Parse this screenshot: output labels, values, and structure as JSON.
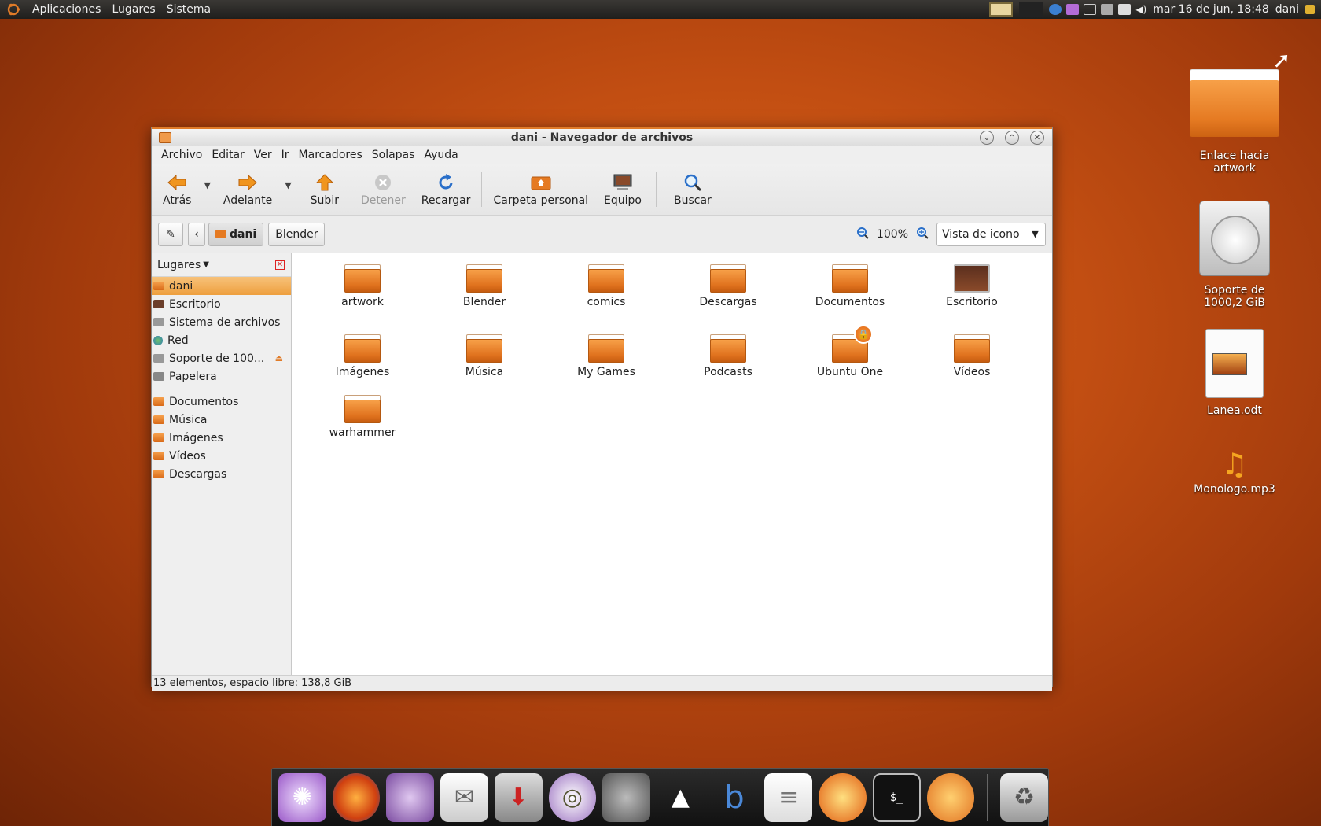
{
  "top_panel": {
    "menus": [
      "Aplicaciones",
      "Lugares",
      "Sistema"
    ],
    "clock": "mar 16 de jun, 18:48",
    "user": "dani"
  },
  "window": {
    "title": "dani - Navegador de archivos",
    "menubar": [
      "Archivo",
      "Editar",
      "Ver",
      "Ir",
      "Marcadores",
      "Solapas",
      "Ayuda"
    ],
    "toolbar": {
      "back": "Atrás",
      "forward": "Adelante",
      "up": "Subir",
      "stop": "Detener",
      "reload": "Recargar",
      "home": "Carpeta personal",
      "computer": "Equipo",
      "search": "Buscar"
    },
    "location": {
      "crumbs": [
        "dani",
        "Blender"
      ],
      "zoom": "100%",
      "view_mode": "Vista de icono"
    },
    "sidebar": {
      "header": "Lugares",
      "places": [
        {
          "label": "dani",
          "icon": "home-folder-icon"
        },
        {
          "label": "Escritorio",
          "icon": "desktop-icon"
        },
        {
          "label": "Sistema de archivos",
          "icon": "drive-icon"
        },
        {
          "label": "Red",
          "icon": "network-icon"
        },
        {
          "label": "Soporte de 100...",
          "icon": "drive-icon"
        },
        {
          "label": "Papelera",
          "icon": "trash-icon"
        }
      ],
      "bookmarks": [
        "Documentos",
        "Música",
        "Imágenes",
        "Vídeos",
        "Descargas"
      ]
    },
    "files": [
      "artwork",
      "Blender",
      "comics",
      "Descargas",
      "Documentos",
      "Escritorio",
      "Imágenes",
      "Música",
      "My Games",
      "Podcasts",
      "Ubuntu One",
      "Vídeos",
      "warhammer"
    ],
    "status": "13 elementos, espacio libre: 138,8 GiB"
  },
  "desktop": {
    "icons": [
      {
        "label": "Enlace hacia artwork"
      },
      {
        "label": "Soporte de 1000,2 GiB"
      },
      {
        "label": "Lanea.odt"
      },
      {
        "label": "Monologo.mp3"
      }
    ]
  },
  "colors": {
    "accent": "#e07b28",
    "selection": "#ee9f3e",
    "desktop": "#c24e12"
  }
}
